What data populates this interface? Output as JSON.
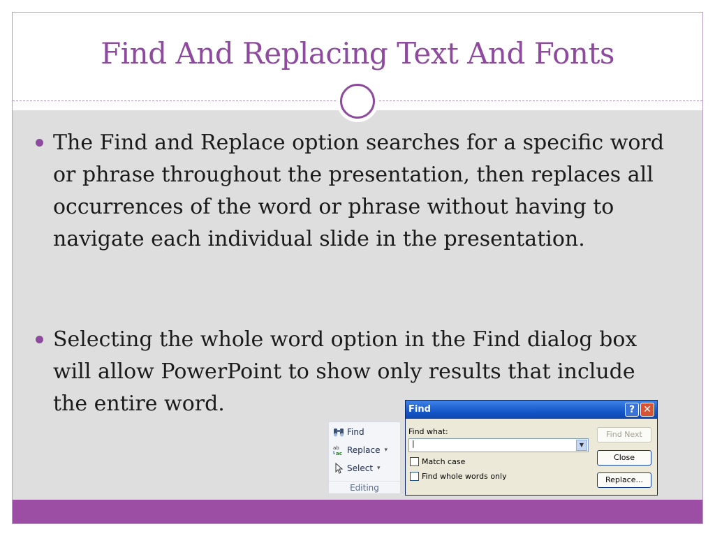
{
  "slide": {
    "title": "Find And Replacing Text And Fonts",
    "bullets": [
      "The Find and Replace option searches for a specific word or phrase throughout the presentation, then replaces all occurrences of the word or phrase without having to navigate each individual slide in the presentation.",
      "Selecting the whole word option in the Find dialog box will allow PowerPoint to show only results that include the entire word."
    ]
  },
  "editing_group": {
    "find_label": "Find",
    "replace_label": "Replace",
    "select_label": "Select",
    "group_label": "Editing",
    "replace_icon_text": "ab ac",
    "caret": "▾"
  },
  "find_dialog": {
    "title": "Find",
    "help_glyph": "?",
    "close_glyph": "✕",
    "find_what_label": "Find what:",
    "find_input_value": "|",
    "combo_glyph": "▼",
    "match_case_label": "Match case",
    "whole_words_label": "Find whole words only",
    "find_next_label": "Find Next",
    "close_label": "Close",
    "replace_label": "Replace..."
  },
  "colors": {
    "accent": "#8e4a9e",
    "bottom_bar": "#9b4ea3",
    "body_bg": "#dedede",
    "dialog_titlebar": "#1557c8"
  }
}
